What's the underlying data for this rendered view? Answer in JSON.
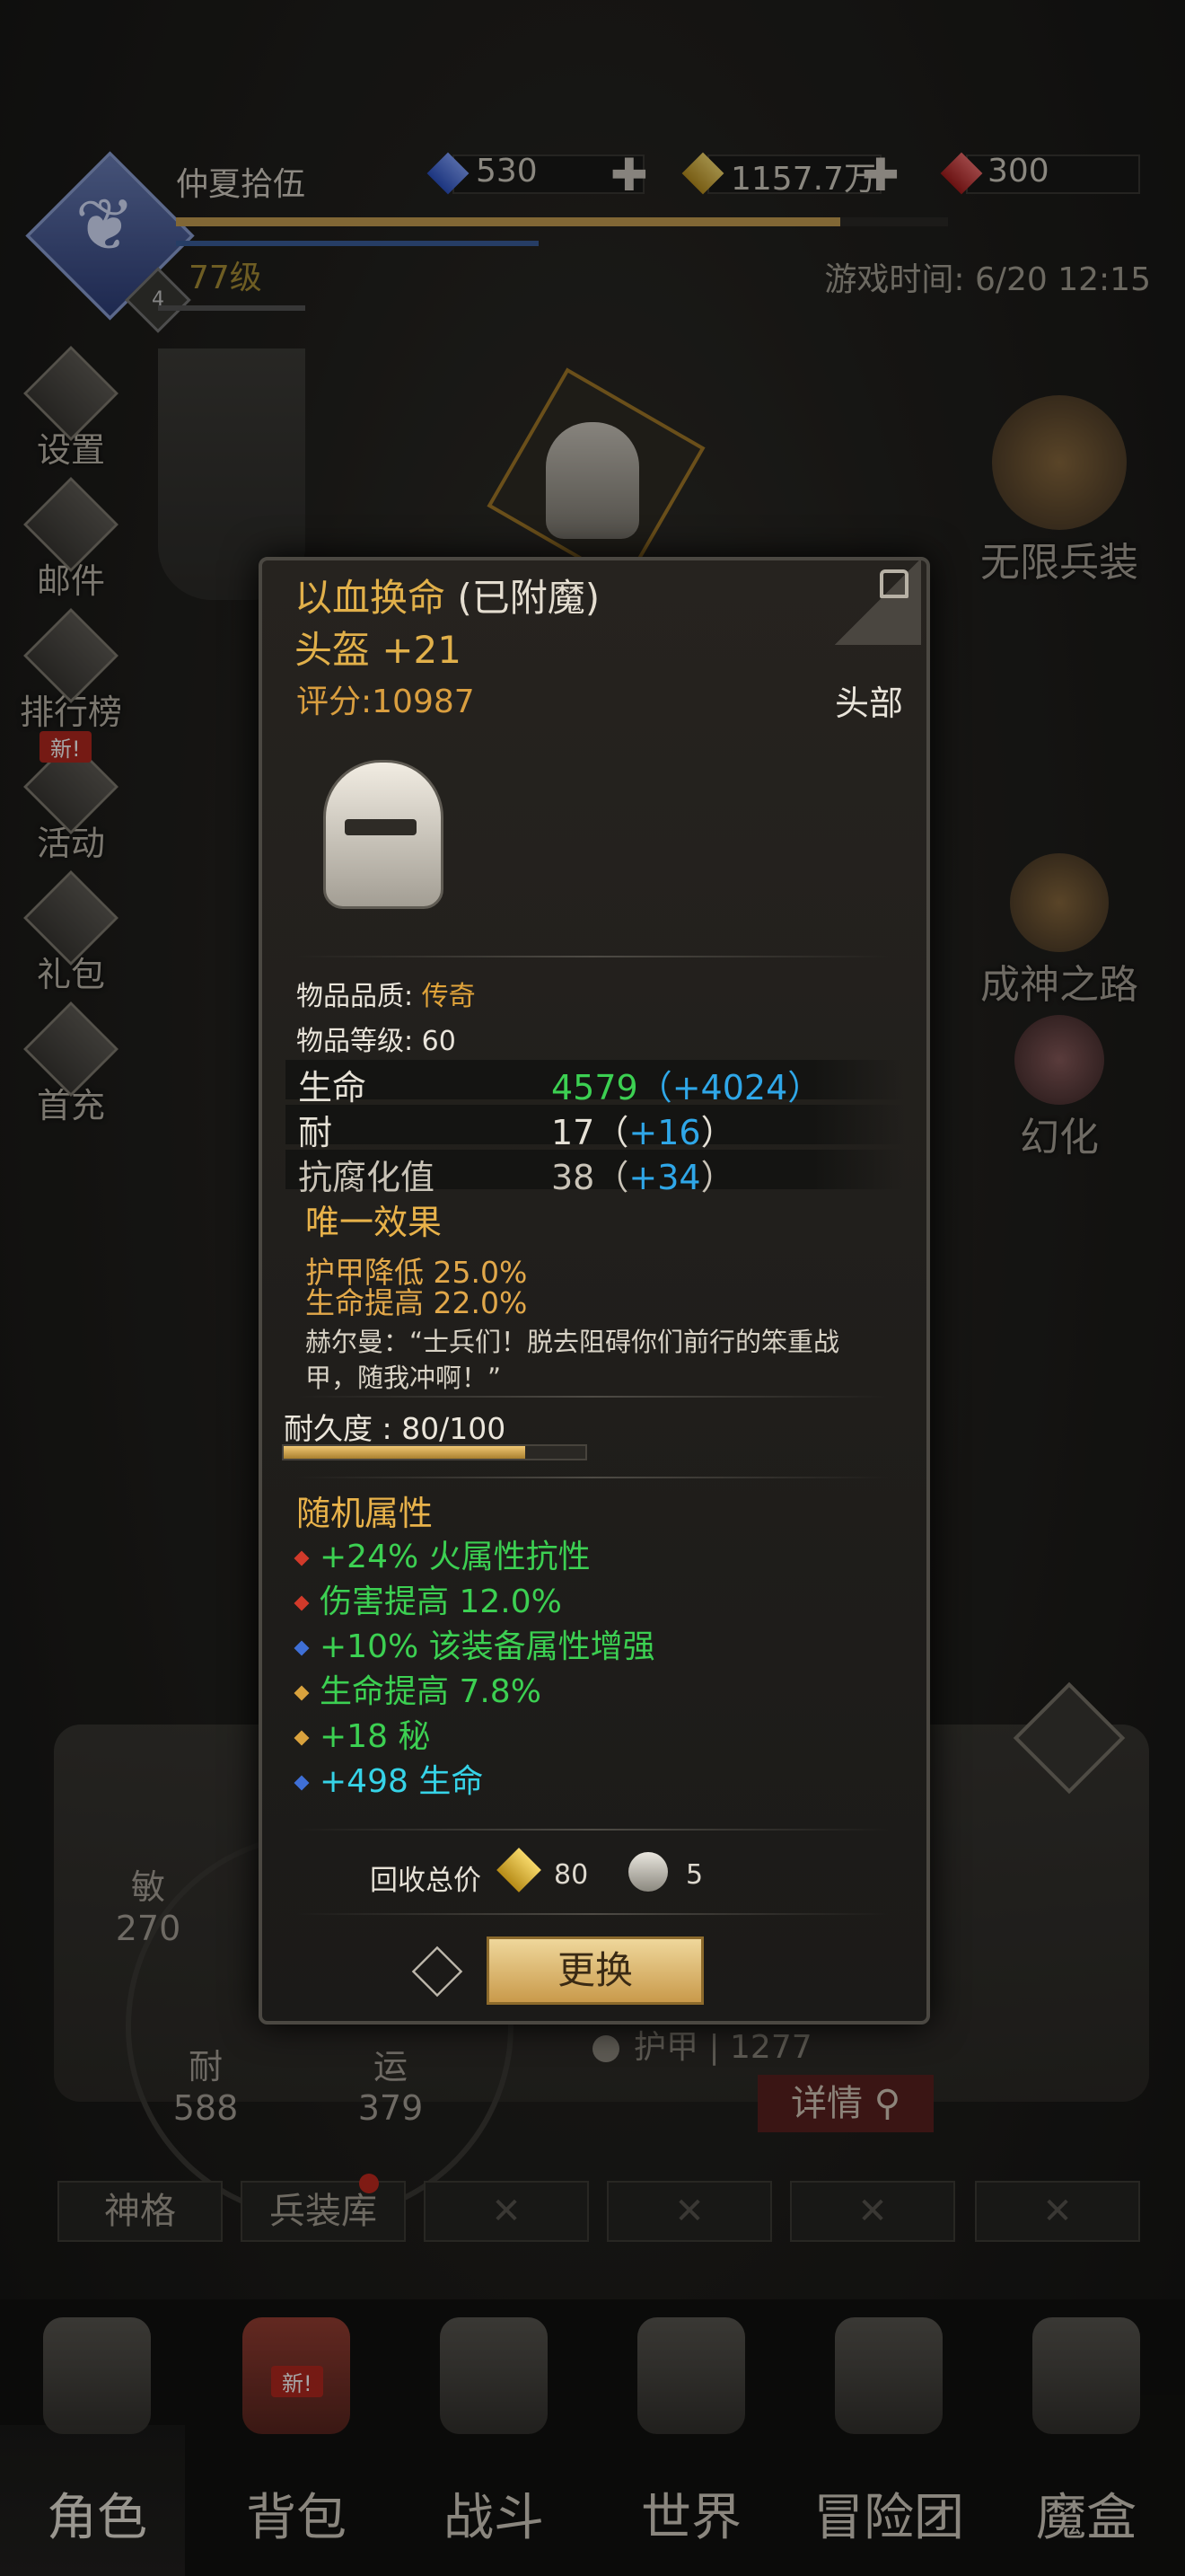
{
  "player": {
    "name": "仲夏拾伍",
    "level_label": "77级",
    "badge": "4",
    "xp_fraction": 0.86
  },
  "currency": [
    {
      "icon": "blue-gem-icon",
      "value": "530",
      "plus": "✚"
    },
    {
      "icon": "gold-gem-icon",
      "value": "1157.7万",
      "plus": "✚"
    },
    {
      "icon": "red-gem-icon",
      "value": "300"
    }
  ],
  "game_time": "游戏时间: 6/20 12:15",
  "side_menu": [
    {
      "label": "设置",
      "icon": "gear-icon"
    },
    {
      "label": "邮件",
      "icon": "mail-icon"
    },
    {
      "label": "排行榜",
      "icon": "leaderboard-icon"
    },
    {
      "label": "活动",
      "icon": "event-icon",
      "tag": "新!"
    },
    {
      "label": "礼包",
      "icon": "gift-icon"
    },
    {
      "label": "首充",
      "icon": "first-recharge-icon"
    }
  ],
  "right_menu": [
    {
      "label": "无限兵装",
      "icon": "infinite-arms-icon"
    },
    {
      "label": "成神之路",
      "icon": "godhood-path-icon"
    },
    {
      "label": "幻化",
      "icon": "transmog-icon"
    }
  ],
  "stats": {
    "agility_label": "敏",
    "agility": "270",
    "stamina_label": "耐",
    "stamina": "588",
    "luck_label": "运",
    "luck": "379",
    "armor_label": "护甲",
    "armor": "1277"
  },
  "detail_button": "详情",
  "sub_tabs": [
    "神格",
    "兵装库",
    "",
    "",
    "",
    ""
  ],
  "nav": [
    {
      "label": "角色",
      "icon": "character-icon"
    },
    {
      "label": "背包",
      "icon": "backpack-icon",
      "tag": "新!"
    },
    {
      "label": "战斗",
      "icon": "battle-icon"
    },
    {
      "label": "世界",
      "icon": "world-map-icon"
    },
    {
      "label": "冒险团",
      "icon": "guild-icon"
    },
    {
      "label": "魔盒",
      "icon": "magic-box-icon"
    }
  ],
  "item": {
    "name": "以血换命",
    "enchant": "(已附魔)",
    "slot_plus": "头盔 +21",
    "score": "评分:10987",
    "part": "头部",
    "quality_label": "物品品质: ",
    "quality": "传奇",
    "level_label": "物品等级: ",
    "level": "60",
    "attributes": [
      {
        "label": "生命",
        "base": "4579",
        "bonus": "（+4024）"
      },
      {
        "label": "耐",
        "base": "17",
        "bonus": "+16"
      },
      {
        "label": "抗腐化值",
        "base": "38",
        "bonus": "+34"
      }
    ],
    "unique_title": "唯一效果",
    "unique_effects": [
      "护甲降低 25.0%",
      "生命提高 22.0%"
    ],
    "quote": "赫尔曼：“士兵们！脱去阻碍你们前行的笨重战甲，随我冲啊！”",
    "durability_label": "耐久度 : 80/100",
    "durability_fraction": 0.8,
    "random_title": "随机属性",
    "random_attrs": [
      {
        "text": "+24% 火属性抗性",
        "gem_color": "#d23a2a",
        "text_color": "#3cd052"
      },
      {
        "text": "伤害提高 12.0%",
        "gem_color": "#d23a2a",
        "text_color": "#3cd052"
      },
      {
        "text": "+10% 该装备属性增强",
        "gem_color": "#3f6fd6",
        "text_color": "#3cd052"
      },
      {
        "text": "生命提高 7.8%",
        "gem_color": "#d9a23d",
        "text_color": "#3cd052"
      },
      {
        "text": "+18 秘",
        "gem_color": "#d9a23d",
        "text_color": "#3cd052"
      },
      {
        "text": "+498 生命",
        "gem_color": "#3f6fd6",
        "text_color": "#36d3e7"
      }
    ],
    "recycle_label": "回收总价",
    "recycle_gold": "80",
    "recycle_silver": "5",
    "replace_button": "更换"
  }
}
